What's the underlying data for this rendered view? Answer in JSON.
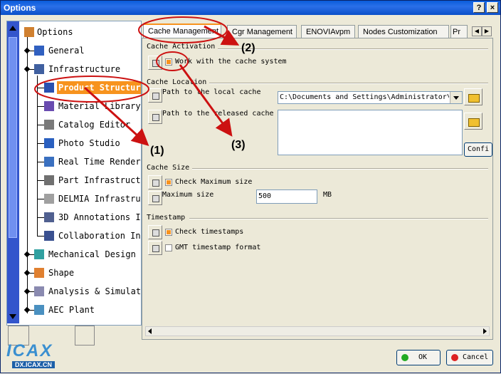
{
  "window": {
    "title": "Options",
    "help_label": "?",
    "close_label": "×"
  },
  "tree": {
    "root": "Options",
    "items": [
      {
        "label": "General",
        "level": 1
      },
      {
        "label": "Infrastructure",
        "level": 1
      },
      {
        "label": "Product Structur",
        "level": 2,
        "selected": true
      },
      {
        "label": "Material Library",
        "level": 2
      },
      {
        "label": "Catalog Editor",
        "level": 2
      },
      {
        "label": "Photo Studio",
        "level": 2
      },
      {
        "label": "Real Time Render",
        "level": 2
      },
      {
        "label": "Part Infrastruct",
        "level": 2
      },
      {
        "label": "DELMIA Infrastru",
        "level": 2
      },
      {
        "label": "3D Annotations I",
        "level": 2
      },
      {
        "label": "Collaboration In",
        "level": 2
      },
      {
        "label": "Mechanical Design",
        "level": 1
      },
      {
        "label": "Shape",
        "level": 1
      },
      {
        "label": "Analysis & Simulat",
        "level": 1
      },
      {
        "label": "AEC Plant",
        "level": 1
      }
    ]
  },
  "tabs": [
    {
      "label": "Cache Management",
      "active": true
    },
    {
      "label": "Cgr Management"
    },
    {
      "label": "ENOVIAvpm"
    },
    {
      "label": "Nodes Customization"
    },
    {
      "label": "Pr"
    }
  ],
  "sections": {
    "activation": {
      "title": "Cache Activation",
      "work_with_cache": "Work with the cache system",
      "work_with_cache_checked": true
    },
    "location": {
      "title": "Cache Location",
      "local_label": "Path to the local cache",
      "local_value": "C:\\Documents and Settings\\Administrator\\",
      "released_label": "Path to the released cache",
      "released_value": "",
      "config_button": "Confi"
    },
    "size": {
      "title": "Cache Size",
      "check_max": "Check Maximum size",
      "check_max_checked": true,
      "max_label": "Maximum size",
      "max_value": "500",
      "unit": "MB"
    },
    "timestamp": {
      "title": "Timestamp",
      "check_ts": "Check timestamps",
      "check_ts_checked": true,
      "gmt": "GMT timestamp format",
      "gmt_checked": false
    }
  },
  "buttons": {
    "ok": "OK",
    "cancel": "Cancel"
  },
  "annotations": {
    "a1": "(1)",
    "a2": "(2)",
    "a3": "(3)",
    "arrow_color": "#cc1111"
  },
  "logo_text": "DX.ICAX.CN",
  "logo_mark": "ICAX"
}
